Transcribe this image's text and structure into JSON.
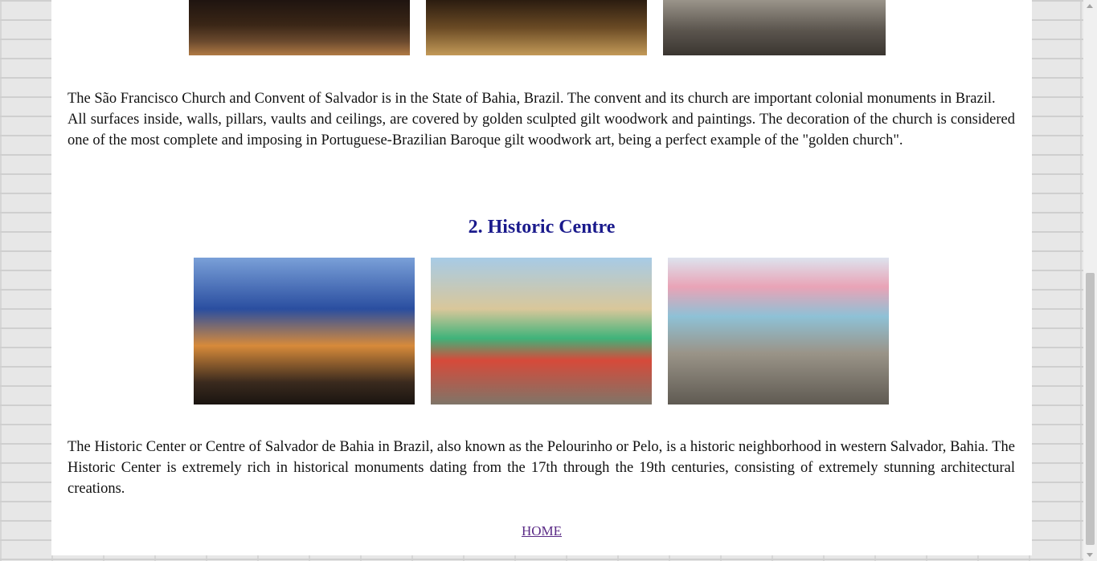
{
  "top_photos": [
    {
      "desc": "church interior dark aisle",
      "colors": [
        "#2b1d14",
        "#6b4a2e",
        "#b07a44"
      ]
    },
    {
      "desc": "church pews golden interior",
      "colors": [
        "#3a2817",
        "#8a6a3a",
        "#caa264"
      ]
    },
    {
      "desc": "plaza with statue",
      "colors": [
        "#4f4a44",
        "#8f8a7f",
        "#c9c4b8"
      ]
    }
  ],
  "section1_text": "The São Francisco Church and Convent of Salvador is in the State of Bahia, Brazil. The convent and its church are important colonial monuments in Brazil.\nAll surfaces inside, walls, pillars, vaults and ceilings, are covered by golden sculpted gilt woodwork and paintings. The decoration of the church is considered one of the most complete and imposing in Portuguese-Brazilian  Baroque gilt woodwork art, being a perfect example of the \"golden church\".",
  "section2": {
    "number": "2.",
    "title": "Historic Centre"
  },
  "historic_photos": [
    {
      "desc": "colorful colonial houses at dusk",
      "colors": [
        "#1a3b7a",
        "#e0823a",
        "#2f2a24"
      ]
    },
    {
      "desc": "church square with cafes",
      "colors": [
        "#a7cbe6",
        "#3fb37a",
        "#d64a3a"
      ]
    },
    {
      "desc": "street with hanging flags",
      "colors": [
        "#cfd7e6",
        "#7f7a70",
        "#e9a3b6"
      ]
    }
  ],
  "section2_text": "The Historic Center or Centre of Salvador de Bahia in Brazil, also known as the Pelourinho or Pelo, is a historic neighborhood in western Salvador, Bahia. The Historic Center is extremely rich in historical monuments dating from the 17th through the 19th centuries, consisting of extremely stunning architectural creations.",
  "home_link": "HOME"
}
